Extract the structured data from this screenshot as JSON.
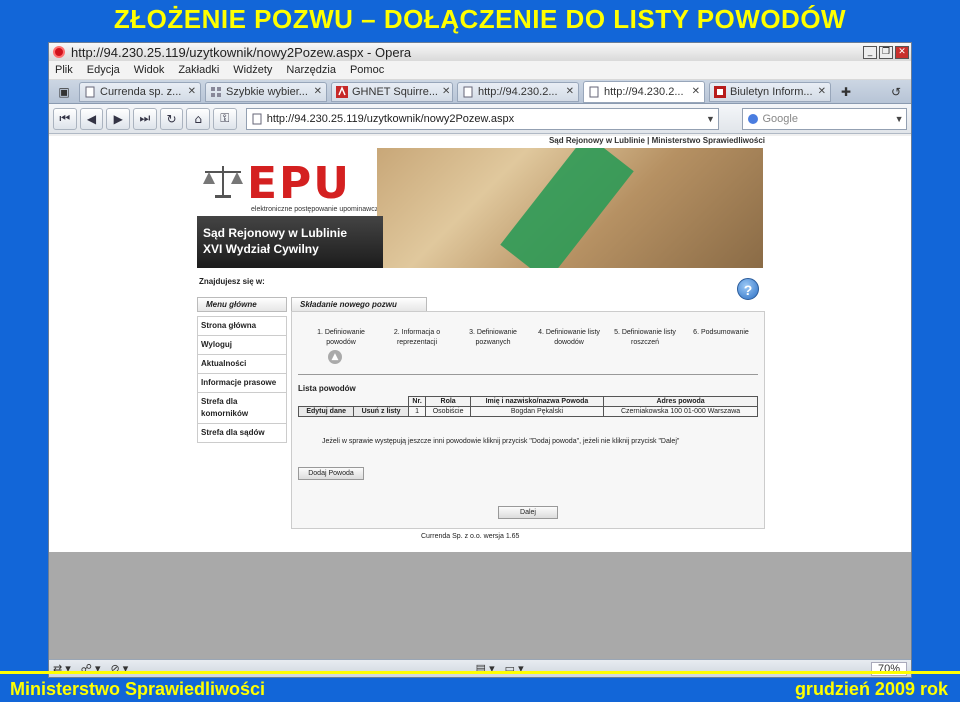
{
  "slide": {
    "title": "ZŁOŻENIE POZWU – DOŁĄCZENIE DO LISTY POWODÓW",
    "footer_left": "Ministerstwo Sprawiedliwości",
    "footer_right": "grudzień 2009 rok",
    "accent_color": "#ffff00",
    "background_color": "#1266d8"
  },
  "browser": {
    "window_title": "http://94.230.25.119/uzytkownik/nowy2Pozew.aspx - Opera",
    "menu": [
      "Plik",
      "Edycja",
      "Widok",
      "Zakładki",
      "Widżety",
      "Narzędzia",
      "Pomoc"
    ],
    "tabs": [
      {
        "label": "Currenda sp. z...",
        "icon": "page-icon"
      },
      {
        "label": "Szybkie wybier...",
        "icon": "speed-dial-icon"
      },
      {
        "label": "GHNET Squirre...",
        "icon": "squirrel-icon"
      },
      {
        "label": "http://94.230.2...",
        "icon": "page-icon"
      },
      {
        "label": "http://94.230.2...",
        "icon": "page-icon"
      },
      {
        "label": "Biuletyn Inform...",
        "icon": "bip-icon"
      }
    ],
    "address": "http://94.230.25.119/uzytkownik/nowy2Pozew.aspx",
    "search_placeholder": "Google",
    "zoom": "70%"
  },
  "page": {
    "top_links": "Sąd Rejonowy w Lublinie | Ministerstwo Sprawiedliwości",
    "logo": "EPU",
    "logo_sub": "elektroniczne postępowanie upominawcze",
    "court_line1": "Sąd Rejonowy w Lublinie",
    "court_line2": "XVI Wydział Cywilny",
    "where": "Znajdujesz się w:",
    "left_menu_title": "Menu główne",
    "left_menu": [
      "Strona główna",
      "Wyloguj",
      "Aktualności",
      "Informacje prasowe",
      "Strefa dla komorników",
      "Strefa dla sądów"
    ],
    "panel_tab": "Składanie nowego pozwu",
    "steps": [
      "1. Definiowanie powodów",
      "2. Informacja o reprezentacji",
      "3. Definiowanie pozwanych",
      "4. Definiowanie listy dowodów",
      "5. Definiowanie listy roszczeń",
      "6. Podsumowanie"
    ],
    "section_title": "Lista powodów",
    "table": {
      "headers": [
        "Nr.",
        "Rola",
        "Imię i nazwisko/nazwa Powoda",
        "Adres powoda"
      ],
      "rows": [
        {
          "edit": "Edytuj dane",
          "remove": "Usuń z listy",
          "nr": "1",
          "rola": "Osobiście",
          "name": "Bogdan Pękalski",
          "address": "Czerniakowska 100 01-000 Warszawa"
        }
      ]
    },
    "note": "Jeżeli w sprawie występują jeszcze inni powodowie kliknij przycisk \"Dodaj powoda\", jeżeli nie kliknij przycisk \"Dalej\"",
    "add_button": "Dodaj Powoda",
    "next_button": "Dalej",
    "version": "Currenda Sp. z o.o. wersja 1.65"
  }
}
